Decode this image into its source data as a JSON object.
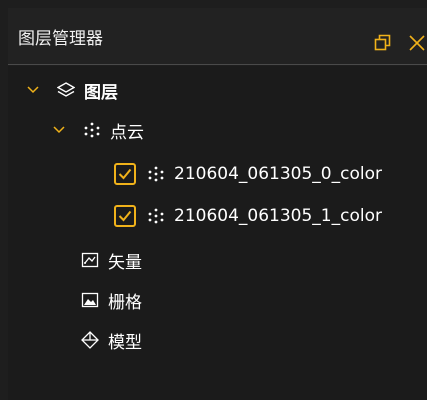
{
  "panel": {
    "title": "图层管理器",
    "restore_icon": "restore-window-icon",
    "close_icon": "close-icon"
  },
  "tree": {
    "root_label": "图层",
    "pointcloud_label": "点云",
    "items": [
      {
        "label": "210604_061305_0_color",
        "checked": true
      },
      {
        "label": "210604_061305_1_color",
        "checked": true
      }
    ],
    "vector_label": "矢量",
    "raster_label": "栅格",
    "model_label": "模型"
  },
  "colors": {
    "accent": "#f0b21a",
    "background": "#1b1b1b",
    "text": "#ffffff"
  }
}
